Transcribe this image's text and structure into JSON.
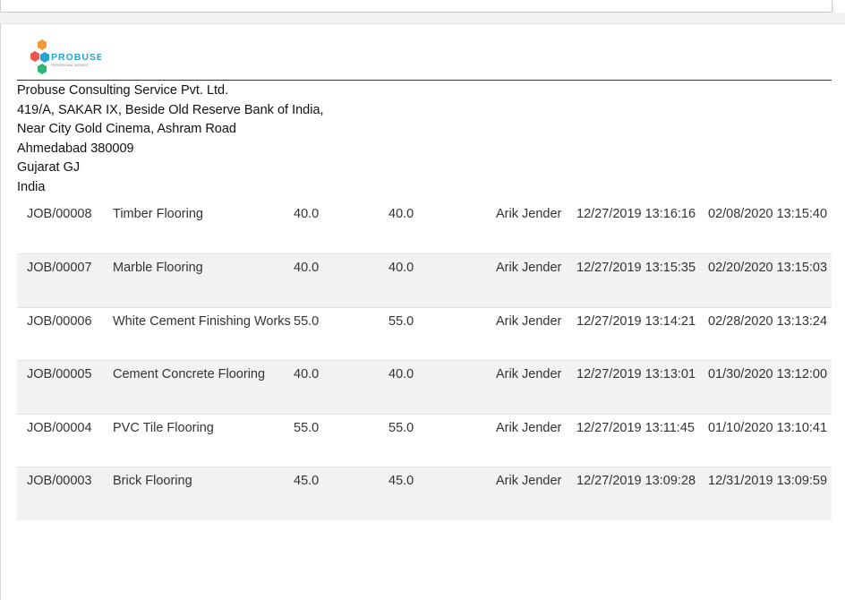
{
  "company": {
    "logo_text": "PROBUSE",
    "logo_tagline": "PROFESSIONAL BUSINESS",
    "address_lines": [
      "Probuse Consulting Service Pvt. Ltd.",
      "419/A, SAKAR IX, Beside Old Reserve Bank of India,",
      "Near City Gold Cinema, Ashram Road",
      "Ahmedabad 380009",
      "Gujarat GJ",
      "India"
    ]
  },
  "jobs": [
    {
      "number": "JOB/00008",
      "name": "Timber Flooring",
      "planned": "40.0",
      "actual": "40.0",
      "user": "Arik Jender",
      "start": "12/27/2019 13:16:16",
      "end": "02/08/2020 13:15:40"
    },
    {
      "number": "JOB/00007",
      "name": "Marble Flooring",
      "planned": "40.0",
      "actual": "40.0",
      "user": "Arik Jender",
      "start": "12/27/2019 13:15:35",
      "end": "02/20/2020 13:15:03"
    },
    {
      "number": "JOB/00006",
      "name": "White Cement Finishing Works",
      "planned": "55.0",
      "actual": "55.0",
      "user": "Arik Jender",
      "start": "12/27/2019 13:14:21",
      "end": "02/28/2020 13:13:24"
    },
    {
      "number": "JOB/00005",
      "name": "Cement Concrete Flooring",
      "planned": "40.0",
      "actual": "40.0",
      "user": "Arik Jender",
      "start": "12/27/2019 13:13:01",
      "end": "01/30/2020 13:12:00"
    },
    {
      "number": "JOB/00004",
      "name": "PVC Tile Flooring",
      "planned": "55.0",
      "actual": "55.0",
      "user": "Arik Jender",
      "start": "12/27/2019 13:11:45",
      "end": "01/10/2020 13:10:41"
    },
    {
      "number": "JOB/00003",
      "name": "Brick Flooring",
      "planned": "45.0",
      "actual": "45.0",
      "user": "Arik Jender",
      "start": "12/27/2019 13:09:28",
      "end": "12/31/2019 13:09:59"
    }
  ],
  "colors": {
    "logo_orange": "#f39c35",
    "logo_red": "#e8584f",
    "logo_green": "#2bb673",
    "logo_blue": "#27a3d4",
    "row_stripe": "#f2f2f2"
  }
}
